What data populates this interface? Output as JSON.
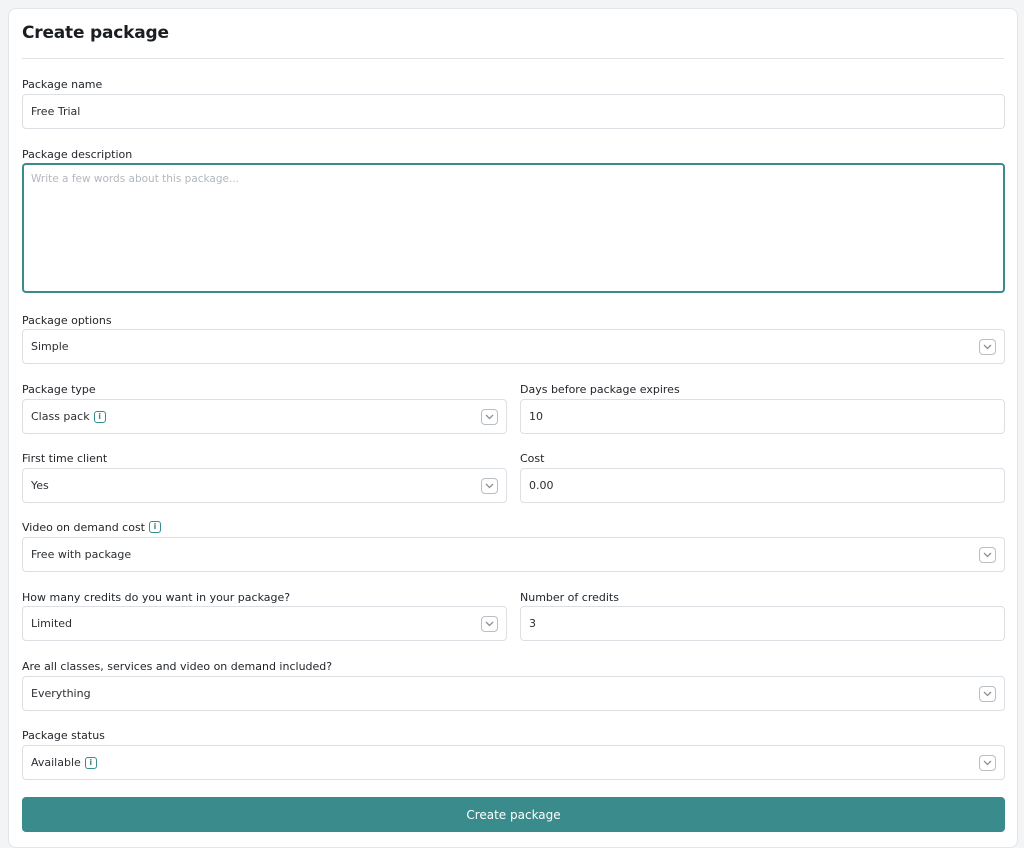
{
  "page": {
    "title": "Create package"
  },
  "form": {
    "package_name": {
      "label": "Package name",
      "value": "Free Trial"
    },
    "package_description": {
      "label": "Package description",
      "placeholder": "Write a few words about this package..."
    },
    "package_options": {
      "label": "Package options",
      "value": "Simple"
    },
    "package_type": {
      "label": "Package type",
      "value": "Class pack"
    },
    "days_before_expiry": {
      "label": "Days before package expires",
      "value": "10"
    },
    "first_time_client": {
      "label": "First time client",
      "value": "Yes"
    },
    "cost": {
      "label": "Cost",
      "value": "0.00"
    },
    "vod_cost": {
      "label": "Video on demand cost",
      "value": "Free with package"
    },
    "credits_mode": {
      "label": "How many credits do you want in your package?",
      "value": "Limited"
    },
    "number_of_credits": {
      "label": "Number of credits",
      "value": "3"
    },
    "inclusion": {
      "label": "Are all classes, services and video on demand included?",
      "value": "Everything"
    },
    "package_status": {
      "label": "Package status",
      "value": "Available"
    },
    "submit_label": "Create package"
  },
  "icons": {
    "info": "info-icon",
    "chevron": "chevron-down-icon",
    "info_glyph": "i"
  },
  "colors": {
    "accent": "#3a8b8c",
    "border": "#dcdfe3",
    "background": "#f3f4f5"
  }
}
